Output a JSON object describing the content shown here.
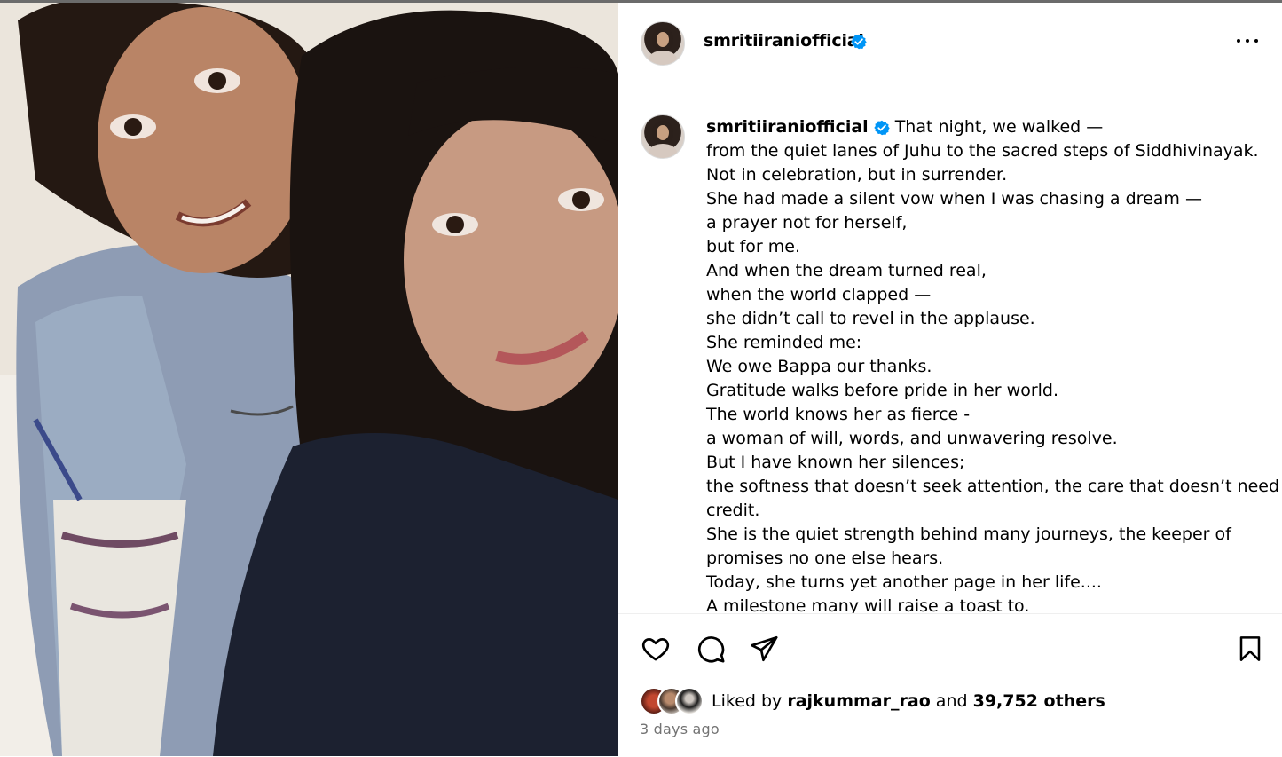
{
  "post": {
    "username": "smritiiraniofficial",
    "verified": true,
    "caption_lines": [
      "That night, we walked —",
      "from the quiet lanes of Juhu to the sacred steps of Siddhivinayak.",
      "Not in celebration, but in surrender.",
      "She had made a silent vow when I was chasing a dream —",
      "a prayer not for herself,",
      "but for me.",
      "And when the dream turned real,",
      "when the world clapped —",
      "she didn’t call to revel in the applause.",
      "She reminded me:",
      "We owe Bappa our thanks.",
      "Gratitude walks before pride in her world.",
      "The world knows her as fierce -",
      "a woman of will, words, and unwavering resolve.",
      "But I have known her silences;",
      "the softness that doesn’t seek attention, the care that doesn’t need",
      "credit.",
      "She is the quiet strength behind many journeys, the keeper of",
      "promises no one else hears.",
      "Today, she turns yet another page in her life....",
      "A milestone many will raise a toast to."
    ],
    "likes": {
      "prefix": "Liked by",
      "top_liker": "rajkummar_rao",
      "connector": "and",
      "others": "39,752 others"
    },
    "timestamp": "3 days ago"
  },
  "icons": {
    "verified": "verified-badge-icon",
    "more": "more-options-icon",
    "like": "heart-icon",
    "comment": "comment-bubble-icon",
    "share": "paper-plane-icon",
    "save": "bookmark-icon"
  },
  "colors": {
    "verified_blue": "#0095f6",
    "muted_text": "#737373",
    "divider": "#efefef"
  }
}
